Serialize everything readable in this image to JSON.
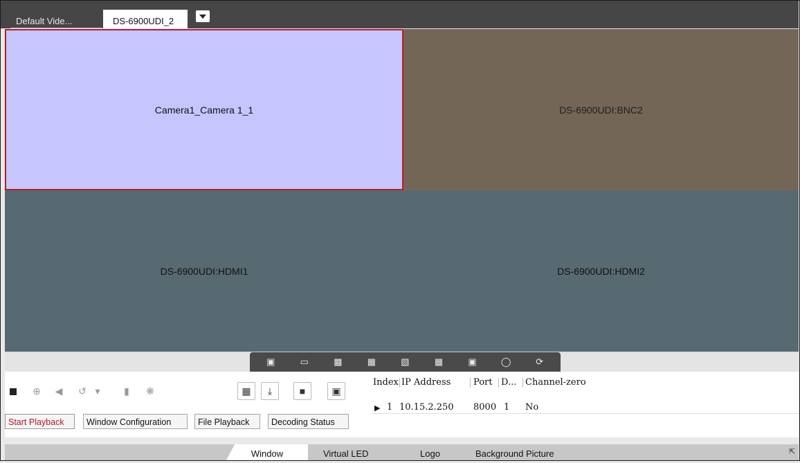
{
  "tabs": {
    "default_label": "Default Vide...",
    "active_label": "DS-6900UDI_2"
  },
  "wall": {
    "cells": [
      {
        "label": "Camera1_Camera 1_1"
      },
      {
        "label": "DS-6900UDI:BNC2"
      },
      {
        "label": "DS-6900UDI:HDMI1"
      },
      {
        "label": "DS-6900UDI:HDMI2"
      }
    ]
  },
  "toolbar_icons": [
    "play-window-icon",
    "monitor-icon",
    "clear-icon",
    "image-icon",
    "image-remove-icon",
    "split-icon",
    "fullscreen-icon",
    "roam-icon",
    "refresh-icon"
  ],
  "controls": {
    "buttons": {
      "start_playback": "Start Playback",
      "window_configuration": "Window Configuration",
      "file_playback": "File Playback",
      "decoding_status": "Decoding Status"
    }
  },
  "device_table": {
    "headers": [
      "Index",
      "IP Address",
      "Port",
      "D...",
      "Channel-zero"
    ],
    "rows": [
      {
        "index": "1",
        "ip": "10.15.2.250",
        "port": "8000",
        "d": "1",
        "channel_zero": "No"
      }
    ]
  },
  "bottom_tabs": [
    "Window",
    "Virtual LED",
    "Logo",
    "Background Picture"
  ],
  "colors": {
    "selected_border": "#b81d29",
    "camera_cell": "#c6c5fe",
    "bnc_cell": "#736657",
    "hdmi_cell": "#576971",
    "header_bg": "#464646"
  }
}
